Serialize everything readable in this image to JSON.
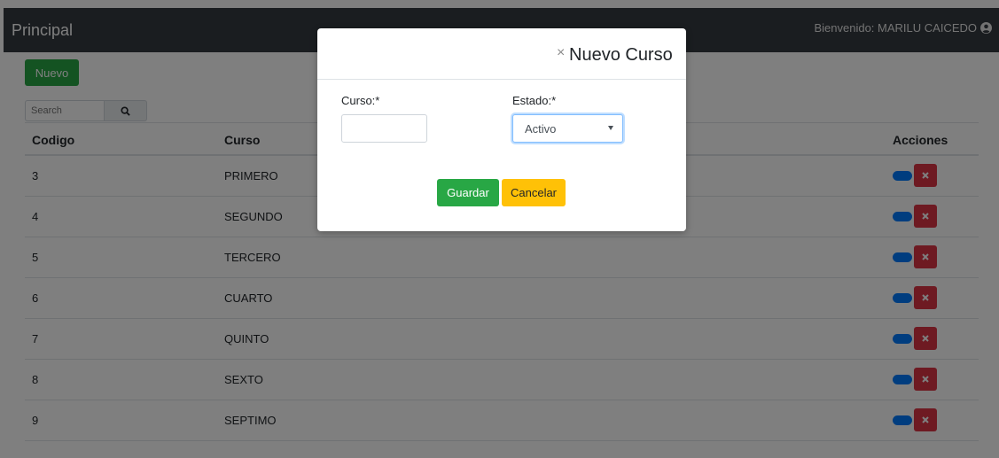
{
  "navbar": {
    "brand": "Principal",
    "welcome": "Bienvenido: MARILU CAICEDO"
  },
  "toolbar": {
    "new_label": "Nuevo",
    "search_placeholder": "Search"
  },
  "table": {
    "headers": {
      "codigo": "Codigo",
      "curso": "Curso",
      "acciones": "Acciones"
    },
    "rows": [
      {
        "codigo": "3",
        "curso": "PRIMERO"
      },
      {
        "codigo": "4",
        "curso": "SEGUNDO"
      },
      {
        "codigo": "5",
        "curso": "TERCERO"
      },
      {
        "codigo": "6",
        "curso": "CUARTO"
      },
      {
        "codigo": "7",
        "curso": "QUINTO"
      },
      {
        "codigo": "8",
        "curso": "SEXTO"
      },
      {
        "codigo": "9",
        "curso": "SEPTIMO"
      }
    ]
  },
  "modal": {
    "close_glyph": "×",
    "title": "Nuevo Curso",
    "curso_label": "Curso:*",
    "curso_value": "",
    "estado_label": "Estado:*",
    "estado_value": "Activo",
    "save_label": "Guardar",
    "cancel_label": "Cancelar"
  },
  "colors": {
    "navbar_bg": "#343a40",
    "success": "#28a745",
    "warning": "#ffc107",
    "danger": "#dc3545",
    "primary": "#007bff"
  },
  "icons": {
    "user": "user-circle-icon",
    "search": "search-icon",
    "delete": "times-icon"
  }
}
